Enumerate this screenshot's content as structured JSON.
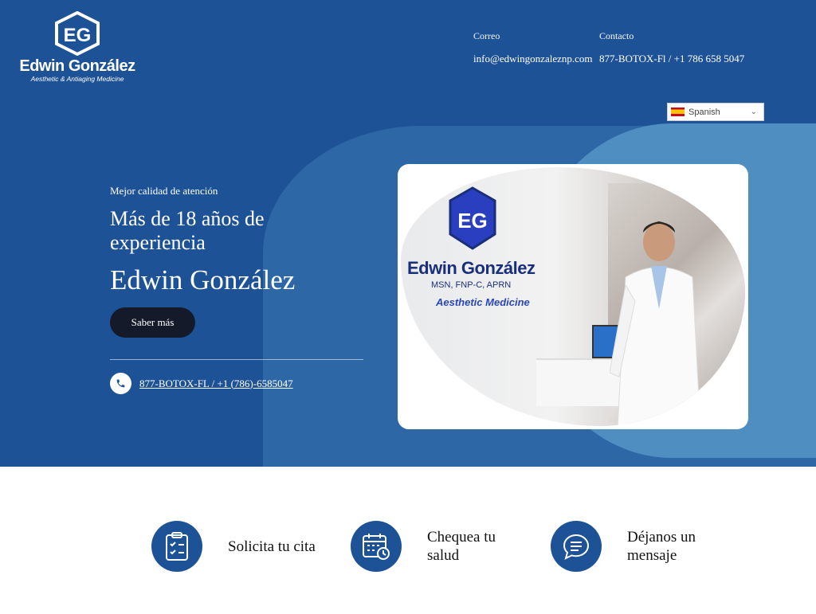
{
  "logo": {
    "name": "Edwin González",
    "subtitle": "Aesthetic & Antiaging Medicine"
  },
  "header": {
    "email_label": "Correo",
    "email_value": "info@edwingonzaleznp.com",
    "phone_label": "Contacto",
    "phone_value": "877-BOTOX-Fl / +1 786 658 5047"
  },
  "language": {
    "selected": "Spanish",
    "icon": "spain-flag-icon"
  },
  "hero": {
    "tagline": "Mejor calidad de atención",
    "headline": "Más de 18 años de experiencia",
    "name": "Edwin González",
    "cta_label": "Saber más",
    "phone_link": "877-BOTOX-FL / +1 (786)-6585047"
  },
  "photo": {
    "sign_name": "Edwin González",
    "sign_credentials": "MSN, FNP-C, APRN",
    "sign_specialty": "Aesthetic Medicine"
  },
  "features": [
    {
      "label": "Solicita tu cita",
      "icon": "clipboard-check-icon"
    },
    {
      "label": "Chequea tu salud",
      "icon": "calendar-clock-icon"
    },
    {
      "label": "Déjanos un mensaje",
      "icon": "chat-bubble-icon"
    }
  ],
  "colors": {
    "primary": "#1e5296",
    "secondary": "#2d67a6",
    "accent": "#4f8ec1",
    "button": "#141a2a"
  }
}
